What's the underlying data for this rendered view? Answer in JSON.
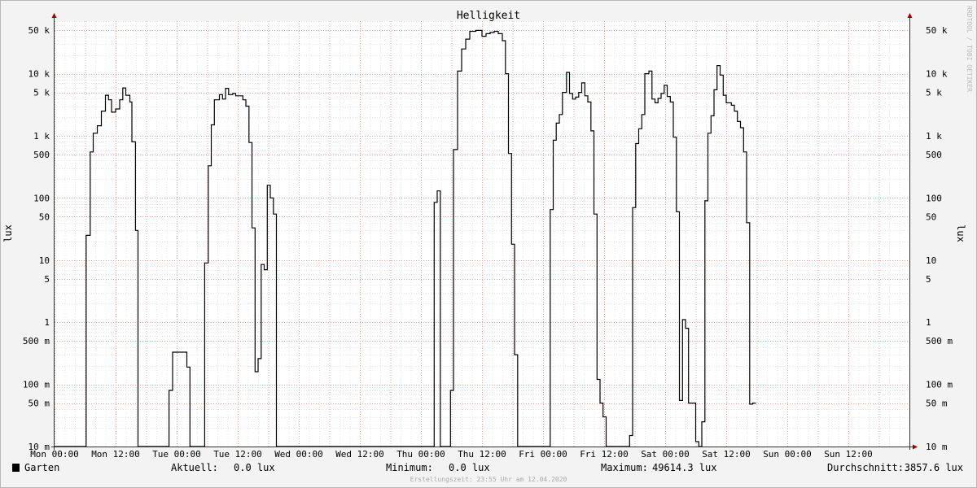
{
  "chart_data": {
    "type": "line",
    "title": "Helligkeit",
    "ylabel": "lux",
    "ylabel_right": "lux",
    "y_scale": "log",
    "ylim": [
      0.01,
      70000
    ],
    "xlim_hours": [
      0,
      168
    ],
    "grid": true,
    "watermark": "RRDTOOL / TOBI OETIKER",
    "x_ticks": [
      {
        "label": "Mon 00:00",
        "hour": 0
      },
      {
        "label": "Mon 12:00",
        "hour": 12
      },
      {
        "label": "Tue 00:00",
        "hour": 24
      },
      {
        "label": "Tue 12:00",
        "hour": 36
      },
      {
        "label": "Wed 00:00",
        "hour": 48
      },
      {
        "label": "Wed 12:00",
        "hour": 60
      },
      {
        "label": "Thu 00:00",
        "hour": 72
      },
      {
        "label": "Thu 12:00",
        "hour": 84
      },
      {
        "label": "Fri 00:00",
        "hour": 96
      },
      {
        "label": "Fri 12:00",
        "hour": 108
      },
      {
        "label": "Sat 00:00",
        "hour": 120
      },
      {
        "label": "Sat 12:00",
        "hour": 132
      },
      {
        "label": "Sun 00:00",
        "hour": 144
      },
      {
        "label": "Sun 12:00",
        "hour": 156
      }
    ],
    "y_ticks": [
      {
        "label": "50 k",
        "value": 50000
      },
      {
        "label": "10 k",
        "value": 10000
      },
      {
        "label": "5 k",
        "value": 5000
      },
      {
        "label": "1 k",
        "value": 1000
      },
      {
        "label": "500",
        "value": 500
      },
      {
        "label": "100",
        "value": 100
      },
      {
        "label": "50",
        "value": 50
      },
      {
        "label": "10",
        "value": 10
      },
      {
        "label": "5",
        "value": 5
      },
      {
        "label": "1",
        "value": 1
      },
      {
        "label": "500 m",
        "value": 0.5
      },
      {
        "label": "100 m",
        "value": 0.1
      },
      {
        "label": "50 m",
        "value": 0.05
      },
      {
        "label": "10 m",
        "value": 0.01
      }
    ],
    "series": [
      {
        "name": "Garten",
        "color": "#000000",
        "points": [
          [
            0,
            0.01
          ],
          [
            6.2,
            0.01
          ],
          [
            6.2,
            25
          ],
          [
            7,
            25
          ],
          [
            7,
            550
          ],
          [
            7.6,
            550
          ],
          [
            7.6,
            1100
          ],
          [
            8.4,
            1100
          ],
          [
            8.4,
            1450
          ],
          [
            9.2,
            1450
          ],
          [
            9.2,
            2500
          ],
          [
            10,
            2500
          ],
          [
            10,
            4500
          ],
          [
            10.6,
            4500
          ],
          [
            10.6,
            3800
          ],
          [
            11.2,
            3800
          ],
          [
            11.2,
            2400
          ],
          [
            12,
            2400
          ],
          [
            12,
            2700
          ],
          [
            12.8,
            2700
          ],
          [
            12.8,
            3800
          ],
          [
            13.4,
            3800
          ],
          [
            13.4,
            5900
          ],
          [
            14,
            5900
          ],
          [
            14,
            4500
          ],
          [
            14.8,
            4500
          ],
          [
            14.8,
            3500
          ],
          [
            15.2,
            3500
          ],
          [
            15.2,
            800
          ],
          [
            15.9,
            800
          ],
          [
            15.9,
            30
          ],
          [
            16.4,
            30
          ],
          [
            16.4,
            0.01
          ],
          [
            22.5,
            0.01
          ],
          [
            22.5,
            0.08
          ],
          [
            23.2,
            0.08
          ],
          [
            23.2,
            0.33
          ],
          [
            26,
            0.33
          ],
          [
            26,
            0.19
          ],
          [
            26.6,
            0.19
          ],
          [
            26.6,
            0.01
          ],
          [
            29.5,
            0.01
          ],
          [
            29.5,
            9
          ],
          [
            30.2,
            9
          ],
          [
            30.2,
            330
          ],
          [
            30.8,
            330
          ],
          [
            30.8,
            1500
          ],
          [
            31.4,
            1500
          ],
          [
            31.4,
            3800
          ],
          [
            32.4,
            3800
          ],
          [
            32.4,
            4600
          ],
          [
            33,
            4600
          ],
          [
            33,
            3900
          ],
          [
            33.6,
            3900
          ],
          [
            33.6,
            5800
          ],
          [
            34.2,
            5800
          ],
          [
            34.2,
            4600
          ],
          [
            35,
            4600
          ],
          [
            35,
            4800
          ],
          [
            35.6,
            4800
          ],
          [
            35.6,
            4400
          ],
          [
            37,
            4400
          ],
          [
            37,
            3800
          ],
          [
            37.6,
            3800
          ],
          [
            37.6,
            3000
          ],
          [
            38.2,
            3000
          ],
          [
            38.2,
            780
          ],
          [
            38.8,
            780
          ],
          [
            38.8,
            33
          ],
          [
            39.4,
            33
          ],
          [
            39.4,
            0.16
          ],
          [
            40,
            0.16
          ],
          [
            40,
            0.26
          ],
          [
            40.6,
            0.26
          ],
          [
            40.6,
            8.5
          ],
          [
            41.2,
            8.5
          ],
          [
            41.2,
            7
          ],
          [
            41.8,
            7
          ],
          [
            41.8,
            160
          ],
          [
            42.4,
            160
          ],
          [
            42.4,
            100
          ],
          [
            43,
            100
          ],
          [
            43,
            55
          ],
          [
            43.6,
            55
          ],
          [
            43.6,
            0.01
          ],
          [
            74.6,
            0.01
          ],
          [
            74.6,
            85
          ],
          [
            75.2,
            85
          ],
          [
            75.2,
            130
          ],
          [
            75.8,
            130
          ],
          [
            75.8,
            0.01
          ],
          [
            77.8,
            0.01
          ],
          [
            77.8,
            0.08
          ],
          [
            78.4,
            0.08
          ],
          [
            78.4,
            600
          ],
          [
            79.2,
            600
          ],
          [
            79.2,
            11000
          ],
          [
            80,
            11000
          ],
          [
            80,
            25000
          ],
          [
            80.8,
            25000
          ],
          [
            80.8,
            36000
          ],
          [
            81.6,
            36000
          ],
          [
            81.6,
            48000
          ],
          [
            82.8,
            48000
          ],
          [
            82.8,
            49614.3
          ],
          [
            84,
            49614.3
          ],
          [
            84,
            40000
          ],
          [
            84.8,
            40000
          ],
          [
            84.8,
            44000
          ],
          [
            85.6,
            44000
          ],
          [
            85.6,
            46000
          ],
          [
            86.4,
            46000
          ],
          [
            86.4,
            48000
          ],
          [
            87.2,
            48000
          ],
          [
            87.2,
            44000
          ],
          [
            88,
            44000
          ],
          [
            88,
            34000
          ],
          [
            88.6,
            34000
          ],
          [
            88.6,
            10000
          ],
          [
            89.2,
            10000
          ],
          [
            89.2,
            520
          ],
          [
            89.8,
            520
          ],
          [
            89.8,
            18
          ],
          [
            90.4,
            18
          ],
          [
            90.4,
            0.3
          ],
          [
            91,
            0.3
          ],
          [
            91,
            0.01
          ],
          [
            97.4,
            0.01
          ],
          [
            97.4,
            65
          ],
          [
            98,
            65
          ],
          [
            98,
            850
          ],
          [
            98.6,
            850
          ],
          [
            98.6,
            1600
          ],
          [
            99.2,
            1600
          ],
          [
            99.2,
            2200
          ],
          [
            99.8,
            2200
          ],
          [
            99.8,
            5000
          ],
          [
            100.6,
            5000
          ],
          [
            100.6,
            10500
          ],
          [
            101.2,
            10500
          ],
          [
            101.2,
            4800
          ],
          [
            101.8,
            4800
          ],
          [
            101.8,
            3900
          ],
          [
            102.4,
            3900
          ],
          [
            102.4,
            4200
          ],
          [
            103,
            4200
          ],
          [
            103,
            5000
          ],
          [
            103.6,
            5000
          ],
          [
            103.6,
            7100
          ],
          [
            104.2,
            7100
          ],
          [
            104.2,
            4400
          ],
          [
            104.8,
            4400
          ],
          [
            104.8,
            3500
          ],
          [
            105.4,
            3500
          ],
          [
            105.4,
            1200
          ],
          [
            106,
            1200
          ],
          [
            106,
            55
          ],
          [
            106.6,
            55
          ],
          [
            106.6,
            0.12
          ],
          [
            107.2,
            0.12
          ],
          [
            107.2,
            0.05
          ],
          [
            107.8,
            0.05
          ],
          [
            107.8,
            0.03
          ],
          [
            108.4,
            0.03
          ],
          [
            108.4,
            0.01
          ],
          [
            113,
            0.01
          ],
          [
            113,
            0.015
          ],
          [
            113.6,
            0.015
          ],
          [
            113.6,
            70
          ],
          [
            114.2,
            70
          ],
          [
            114.2,
            750
          ],
          [
            114.8,
            750
          ],
          [
            114.8,
            1300
          ],
          [
            115.4,
            1300
          ],
          [
            115.4,
            2200
          ],
          [
            116,
            2200
          ],
          [
            116,
            10000
          ],
          [
            116.8,
            10000
          ],
          [
            116.8,
            11000
          ],
          [
            117.4,
            11000
          ],
          [
            117.4,
            3900
          ],
          [
            118,
            3900
          ],
          [
            118,
            3400
          ],
          [
            118.6,
            3400
          ],
          [
            118.6,
            4000
          ],
          [
            119.2,
            4000
          ],
          [
            119.2,
            4800
          ],
          [
            119.8,
            4800
          ],
          [
            119.8,
            6500
          ],
          [
            120.4,
            6500
          ],
          [
            120.4,
            4300
          ],
          [
            121,
            4300
          ],
          [
            121,
            3500
          ],
          [
            121.6,
            3500
          ],
          [
            121.6,
            950
          ],
          [
            122.2,
            950
          ],
          [
            122.2,
            60
          ],
          [
            122.8,
            60
          ],
          [
            122.8,
            0.055
          ],
          [
            123.4,
            0.055
          ],
          [
            123.4,
            1.1
          ],
          [
            124,
            1.1
          ],
          [
            124,
            0.8
          ],
          [
            124.6,
            0.8
          ],
          [
            124.6,
            0.05
          ],
          [
            126,
            0.05
          ],
          [
            126,
            0.012
          ],
          [
            126.6,
            0.012
          ],
          [
            126.6,
            0.01
          ],
          [
            127.2,
            0.01
          ],
          [
            127.2,
            0.025
          ],
          [
            127.8,
            0.025
          ],
          [
            127.8,
            90
          ],
          [
            128.4,
            90
          ],
          [
            128.4,
            1100
          ],
          [
            129,
            1100
          ],
          [
            129,
            2100
          ],
          [
            129.6,
            2100
          ],
          [
            129.6,
            5500
          ],
          [
            130.2,
            5500
          ],
          [
            130.2,
            13500
          ],
          [
            130.8,
            13500
          ],
          [
            130.8,
            9500
          ],
          [
            131.4,
            9500
          ],
          [
            131.4,
            4500
          ],
          [
            132,
            4500
          ],
          [
            132,
            3400
          ],
          [
            133,
            3400
          ],
          [
            133,
            3100
          ],
          [
            133.6,
            3100
          ],
          [
            133.6,
            2500
          ],
          [
            134.2,
            2500
          ],
          [
            134.2,
            1700
          ],
          [
            134.8,
            1700
          ],
          [
            134.8,
            1350
          ],
          [
            135.4,
            1350
          ],
          [
            135.4,
            550
          ],
          [
            136,
            550
          ],
          [
            136,
            40
          ],
          [
            136.6,
            40
          ],
          [
            136.6,
            0.048
          ],
          [
            137.2,
            0.048
          ],
          [
            137.2,
            0.05
          ],
          [
            137.8,
            0.05
          ]
        ]
      }
    ]
  },
  "legend": {
    "series_name": "Garten",
    "current_label": "Aktuell:",
    "current_value": "0.0 lux",
    "min_label": "Minimum:",
    "min_value": "0.0 lux",
    "max_label": "Maximum:",
    "max_value": "49614.3 lux",
    "avg_label": "Durchschnitt:",
    "avg_value": "3857.6 lux"
  },
  "footer": "Erstellungszeit: 23:55 Uhr am 12.04.2020"
}
